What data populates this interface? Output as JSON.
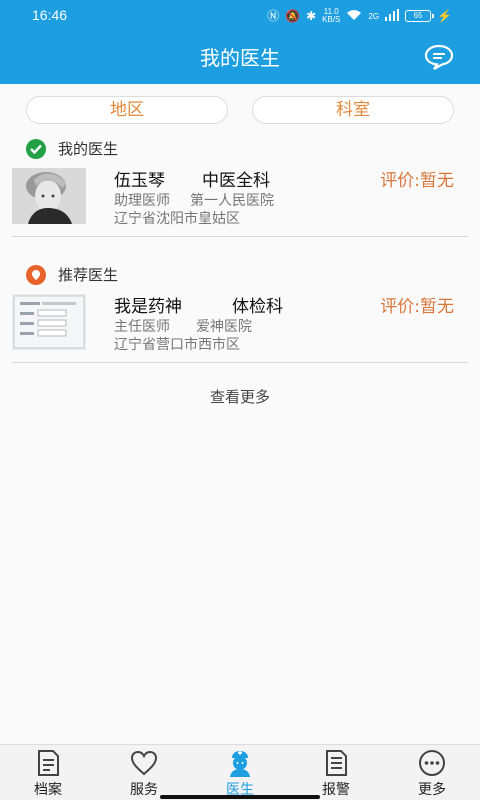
{
  "status_bar": {
    "time": "16:46",
    "speed_value": "11.0",
    "speed_unit": "KB/S",
    "network": "2G",
    "battery": "65"
  },
  "header": {
    "title": "我的医生",
    "message_icon": "chat-bubble-icon"
  },
  "filters": {
    "region_label": "地区",
    "department_label": "科室"
  },
  "my_doctors": {
    "section_title": "我的医生",
    "icon": "check-circle-icon",
    "items": [
      {
        "name": "伍玉琴",
        "department": "中医全科",
        "rating": "评价:暂无",
        "title": "助理医师",
        "hospital": "第一人民医院",
        "address": "辽宁省沈阳市皇姑区"
      }
    ]
  },
  "recommended_doctors": {
    "section_title": "推荐医生",
    "icon": "location-pin-icon",
    "items": [
      {
        "name": "我是药神",
        "department": "体检科",
        "rating": "评价:暂无",
        "title": "主任医师",
        "hospital": "爱神医院",
        "address": "辽宁省营口市西市区"
      }
    ]
  },
  "more_link": "查看更多",
  "tabs": [
    {
      "label": "档案",
      "icon": "document-icon"
    },
    {
      "label": "服务",
      "icon": "heart-icon"
    },
    {
      "label": "医生",
      "icon": "doctor-icon",
      "active": true
    },
    {
      "label": "报警",
      "icon": "alarm-document-icon"
    },
    {
      "label": "更多",
      "icon": "more-dots-icon"
    }
  ],
  "colors": {
    "primary": "#1c9ee0",
    "accent_orange": "#e58a3c",
    "rating": "#d9763a",
    "check_green": "#22a045",
    "pin_orange": "#e8622c"
  }
}
